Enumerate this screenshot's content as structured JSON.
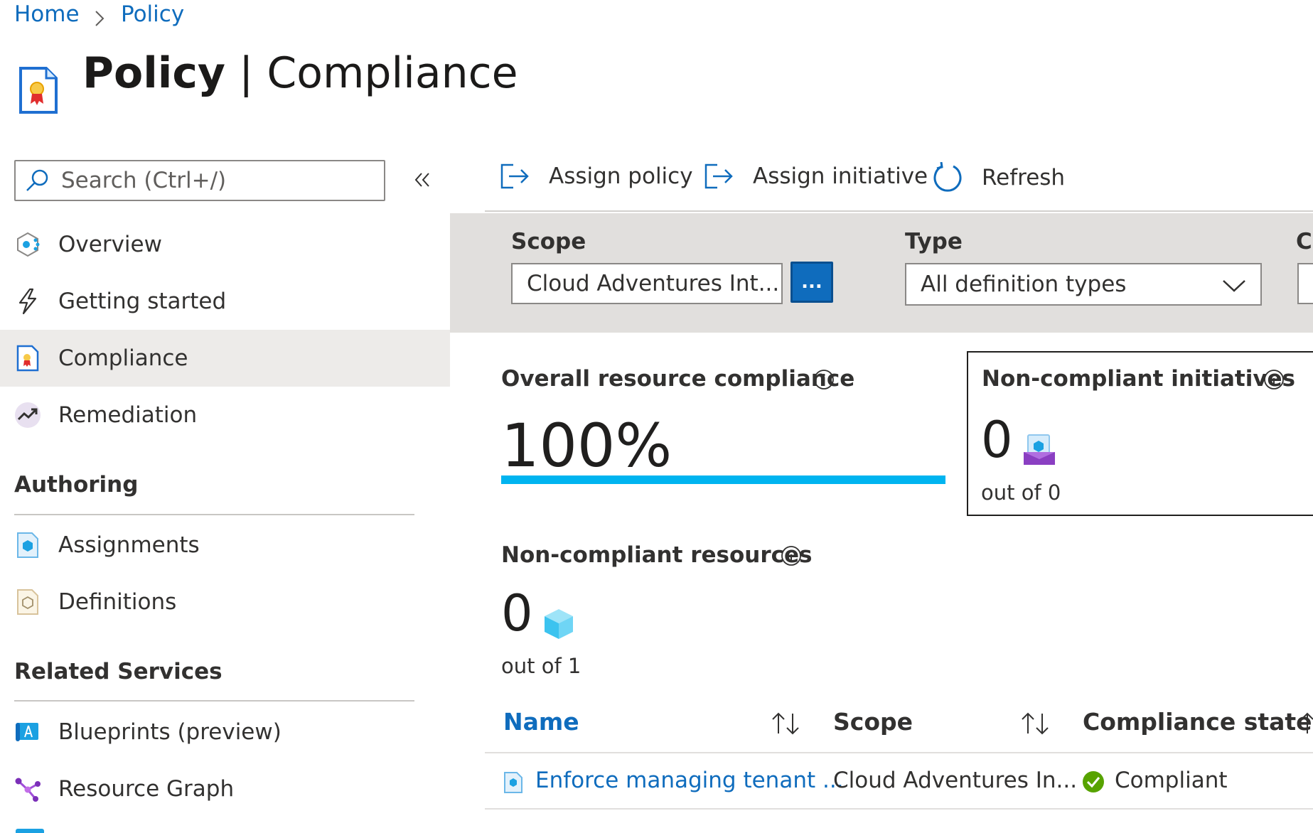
{
  "breadcrumb": {
    "home": "Home",
    "current": "Policy"
  },
  "title": {
    "bold": "Policy",
    "separator": " | ",
    "rest": "Compliance",
    "icon": "policy-certificate-icon"
  },
  "sidebar": {
    "search_placeholder": "Search (Ctrl+/)",
    "items": [
      {
        "label": "Overview",
        "icon": "overview-icon"
      },
      {
        "label": "Getting started",
        "icon": "lightning-icon"
      },
      {
        "label": "Compliance",
        "icon": "compliance-icon",
        "selected": true
      },
      {
        "label": "Remediation",
        "icon": "remediation-icon"
      }
    ],
    "sections": [
      {
        "title": "Authoring",
        "items": [
          {
            "label": "Assignments",
            "icon": "assignments-icon"
          },
          {
            "label": "Definitions",
            "icon": "definitions-icon"
          }
        ]
      },
      {
        "title": "Related Services",
        "items": [
          {
            "label": "Blueprints (preview)",
            "icon": "blueprints-icon"
          },
          {
            "label": "Resource Graph",
            "icon": "resource-graph-icon"
          }
        ]
      }
    ]
  },
  "toolbar": {
    "assign_policy": "Assign policy",
    "assign_initiative": "Assign initiative",
    "refresh": "Refresh"
  },
  "filters": {
    "scope_label": "Scope",
    "scope_value": "Cloud Adventures Int...",
    "scope_button": "...",
    "type_label": "Type",
    "type_value": "All definition types",
    "third_label_partial": "C"
  },
  "cards": {
    "overall": {
      "title": "Overall resource compliance",
      "value": "100%",
      "progress": 1.0
    },
    "initiatives": {
      "title": "Non-compliant initiatives",
      "value": "0",
      "sub": "out of 0"
    },
    "resources": {
      "title": "Non-compliant resources",
      "value": "0",
      "sub": "out of 1"
    }
  },
  "table": {
    "headers": {
      "name": "Name",
      "scope": "Scope",
      "state": "Compliance state"
    },
    "rows": [
      {
        "name": "Enforce managing tenant ...",
        "scope": "Cloud Adventures In...",
        "state": "Compliant"
      }
    ]
  },
  "colors": {
    "accent": "#0f6cbd",
    "progress": "#00b4f0",
    "compliant": "#57a300"
  }
}
